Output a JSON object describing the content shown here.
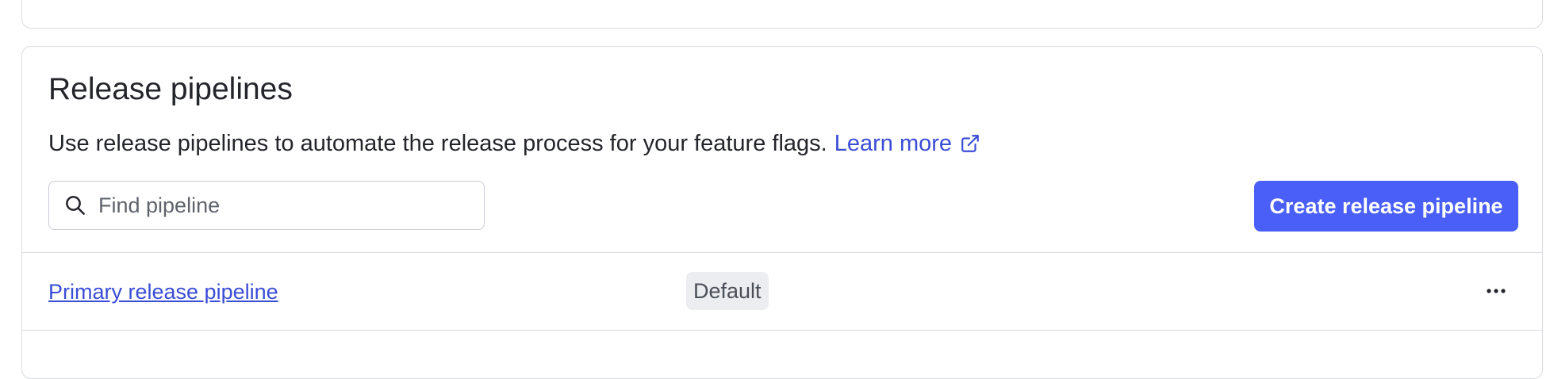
{
  "release_pipelines": {
    "title": "Release pipelines",
    "description": "Use release pipelines to automate the release process for your feature flags.",
    "learn_more_label": "Learn more",
    "learn_more_icon": "external-link-icon",
    "search": {
      "placeholder": "Find pipeline",
      "value": "",
      "icon": "search-icon"
    },
    "create_button_label": "Create release pipeline",
    "pipelines": [
      {
        "name": "Primary release pipeline",
        "badge": "Default",
        "actions_icon": "more-horizontal-icon"
      }
    ]
  },
  "colors": {
    "accent": "#4a5ff7",
    "link": "#3a4dd6",
    "text": "#23252a",
    "border": "#d9dbe0",
    "badge_bg": "#ebedf0"
  }
}
